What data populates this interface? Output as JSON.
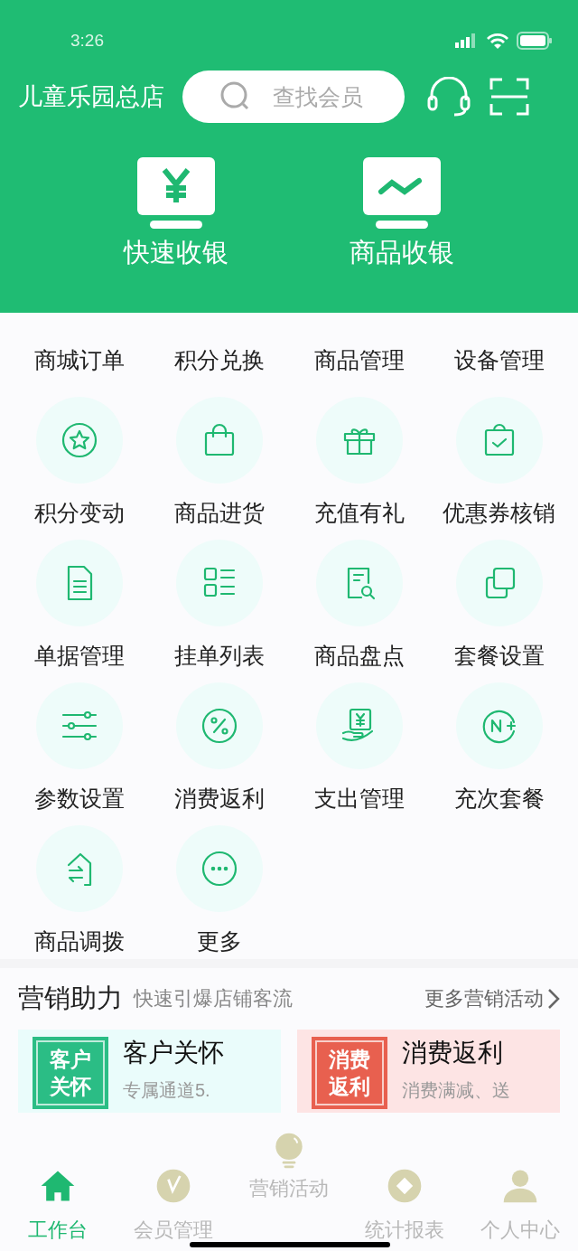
{
  "status_bar": {
    "time": "3:26"
  },
  "header": {
    "store": "儿童乐园总店",
    "search": {
      "placeholder": "查找会员"
    }
  },
  "quick_actions": [
    {
      "label": "快速收银"
    },
    {
      "label": "商品收银"
    }
  ],
  "menu_grid": [
    {
      "label": "商城订单",
      "icon_hidden": true
    },
    {
      "label": "积分兑换",
      "icon_hidden": true
    },
    {
      "label": "商品管理",
      "icon_hidden": true
    },
    {
      "label": "设备管理",
      "icon_hidden": true
    },
    {
      "label": "积分变动",
      "icon_hidden": false
    },
    {
      "label": "商品进货",
      "icon_hidden": false
    },
    {
      "label": "充值有礼",
      "icon_hidden": false
    },
    {
      "label": "优惠券核销",
      "icon_hidden": false
    },
    {
      "label": "单据管理",
      "icon_hidden": false
    },
    {
      "label": "挂单列表",
      "icon_hidden": false
    },
    {
      "label": "商品盘点",
      "icon_hidden": false
    },
    {
      "label": "套餐设置",
      "icon_hidden": false
    },
    {
      "label": "参数设置",
      "icon_hidden": false
    },
    {
      "label": "消费返利",
      "icon_hidden": false
    },
    {
      "label": "支出管理",
      "icon_hidden": false
    },
    {
      "label": "充次套餐",
      "icon_hidden": false
    },
    {
      "label": "商品调拨",
      "icon_hidden": false
    },
    {
      "label": "更多",
      "icon_hidden": false
    }
  ],
  "marketing": {
    "title": "营销助力",
    "subtitle": "快速引爆店铺客流",
    "more_link": "更多营销活动",
    "cards": [
      {
        "badge_line_1": "客户",
        "badge_line_2": "关怀",
        "title": "客户关怀",
        "description": "专属通道5.",
        "color": "#2bbd85"
      },
      {
        "badge_line_1": "消费",
        "badge_line_2": "返利",
        "title": "消费返利",
        "description": "消费满减、送",
        "color": "#e8604f"
      }
    ]
  },
  "tab_bar": [
    {
      "label": "工作台",
      "selected": true,
      "kind": "normal"
    },
    {
      "label": "会员管理",
      "selected": false,
      "kind": "normal"
    },
    {
      "label": "营销活动",
      "selected": false,
      "kind": "center"
    },
    {
      "label": "统计报表",
      "selected": false,
      "kind": "normal"
    },
    {
      "label": "个人中心",
      "selected": false,
      "kind": "normal"
    }
  ]
}
